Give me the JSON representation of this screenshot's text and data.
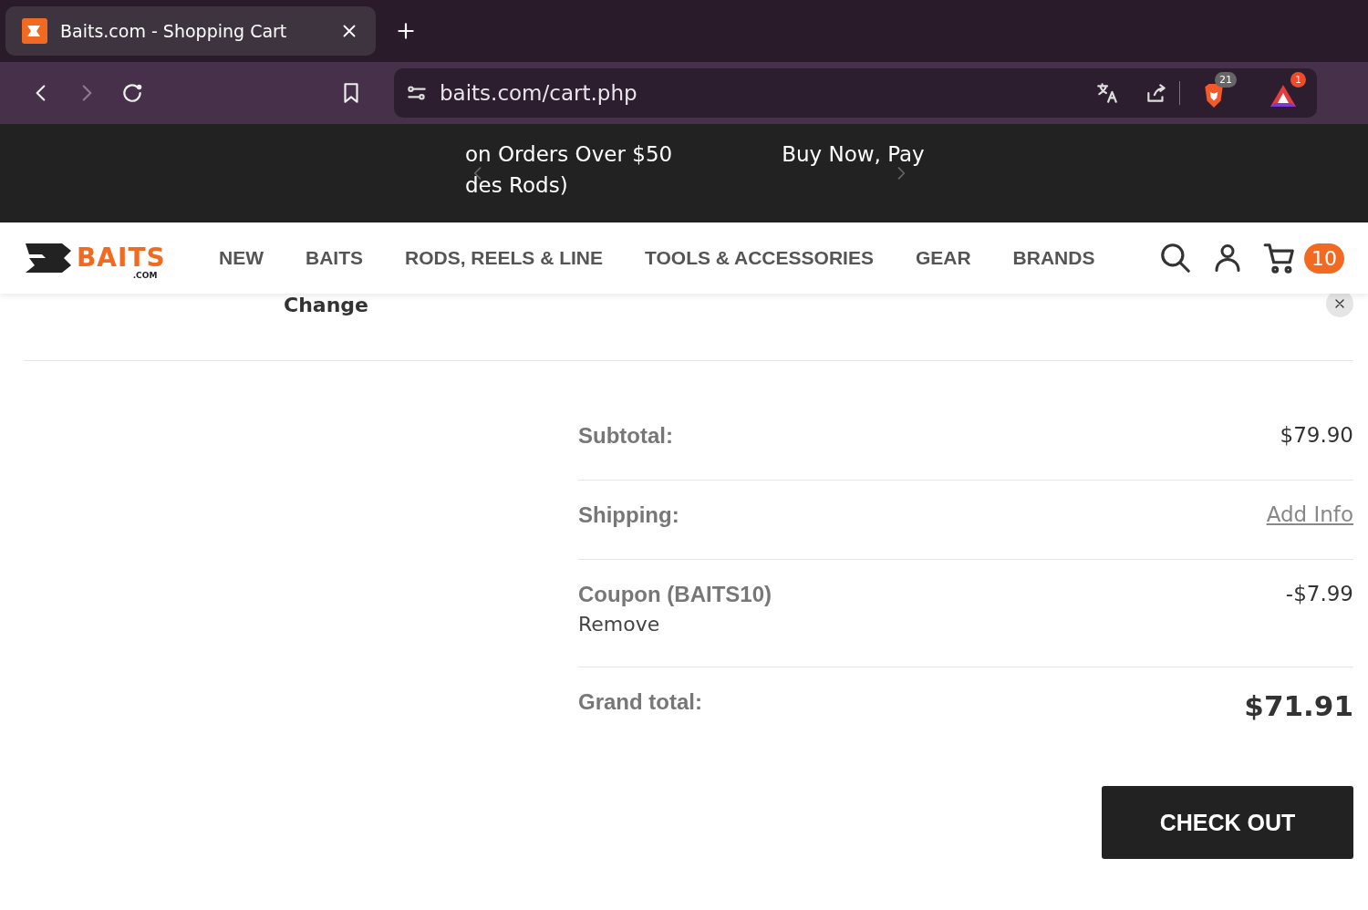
{
  "browser": {
    "tab": {
      "title": "Baits.com - Shopping Cart",
      "selected": true
    },
    "address": "baits.com/cart.php",
    "shields_count": "21",
    "rewards_count": "1"
  },
  "promo": {
    "lines": [
      "on Orders Over $50",
      "des Rods)"
    ],
    "second": "Buy Now, Pay"
  },
  "header": {
    "logo": {
      "word": "BAITS",
      "suffix": ".COM"
    },
    "nav": [
      "NEW",
      "BAITS",
      "RODS, REELS & LINE",
      "TOOLS & ACCESSORIES",
      "GEAR",
      "BRANDS"
    ],
    "cart_count": "10"
  },
  "cart_item": {
    "change": "Change"
  },
  "totals": [
    {
      "kind": "plain",
      "label": "Subtotal:",
      "value": "$79.90"
    },
    {
      "kind": "link",
      "label": "Shipping:",
      "value": "Add Info"
    },
    {
      "kind": "coupon",
      "label": "Coupon",
      "code": "(BAITS10)",
      "action": "Remove",
      "value": "-$7.99"
    },
    {
      "kind": "grand",
      "label": "Grand total:",
      "value": "$71.91"
    }
  ],
  "checkout": "CHECK OUT"
}
